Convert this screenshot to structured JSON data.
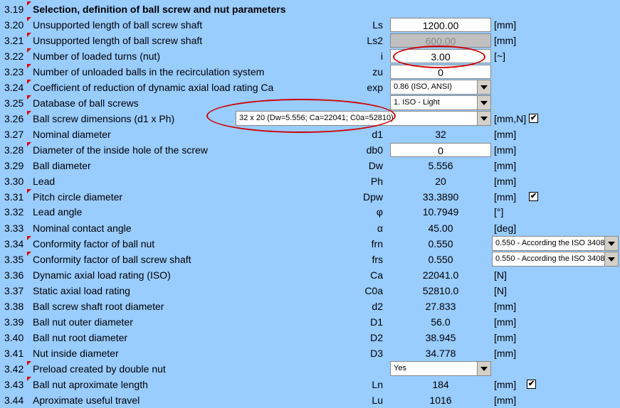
{
  "title_row": {
    "num": "3.19",
    "label": "Selection, definition of ball screw and nut parameters"
  },
  "rows": [
    {
      "num": "3.20",
      "label": "Unsupported length of ball screw shaft",
      "sym": "Ls",
      "value": "1200.00",
      "unit": "[mm]"
    },
    {
      "num": "3.21",
      "label": "Unsupported length of ball screw shaft",
      "sym": "Ls2",
      "value": "600.00",
      "unit": "[mm]"
    },
    {
      "num": "3.22",
      "label": "Number of loaded turns (nut)",
      "sym": "i",
      "value": "3.00",
      "unit": "[~]"
    },
    {
      "num": "3.23",
      "label": "Number of unloaded balls in the recirculation system",
      "sym": "zu",
      "value": "0",
      "unit": ""
    },
    {
      "num": "3.24",
      "label": "Coefficient of reduction of dynamic axial load rating Ca",
      "sym": "exp",
      "select": "0.86 (ISO, ANSI)",
      "unit": ""
    },
    {
      "num": "3.25",
      "label": "Database of ball screws",
      "sym": "",
      "select": "1. ISO - Light",
      "unit": ""
    },
    {
      "num": "3.26",
      "label": "Ball screw dimensions (d1 x Ph)",
      "sym": "",
      "select": "32 x 20  (Dw=5.556;  Ca=22041;  C0a=52810)",
      "unit": "[mm,N]"
    },
    {
      "num": "3.27",
      "label": "Nominal diameter",
      "sym": "d1",
      "value": "32",
      "unit": "[mm]"
    },
    {
      "num": "3.28",
      "label": "Diameter of the inside hole of the screw",
      "sym": "db0",
      "value": "0",
      "unit": "[mm]"
    },
    {
      "num": "3.29",
      "label": "Ball diameter",
      "sym": "Dw",
      "value": "5.556",
      "unit": "[mm]"
    },
    {
      "num": "3.30",
      "label": "Lead",
      "sym": "Ph",
      "value": "20",
      "unit": "[mm]"
    },
    {
      "num": "3.31",
      "label": "Pitch circle diameter",
      "sym": "Dpw",
      "value": "33.3890",
      "unit": "[mm]"
    },
    {
      "num": "3.32",
      "label": "Lead angle",
      "sym": "φ",
      "value": "10.7949",
      "unit": "[°]"
    },
    {
      "num": "3.33",
      "label": "Nominal contact angle",
      "sym": "α",
      "value": "45.00",
      "unit": "[deg]"
    },
    {
      "num": "3.34",
      "label": "Conformity factor of ball nut",
      "sym": "frn",
      "value": "0.550",
      "unit": "",
      "side_select": "0.550 - According the ISO 3408"
    },
    {
      "num": "3.35",
      "label": "Conformity factor of ball screw shaft",
      "sym": "frs",
      "value": "0.550",
      "unit": "",
      "side_select": "0.550 - According the ISO 3408"
    },
    {
      "num": "3.36",
      "label": "Dynamic axial load rating (ISO)",
      "sym": "Ca",
      "value": "22041.0",
      "unit": "[N]"
    },
    {
      "num": "3.37",
      "label": "Static axial load rating",
      "sym": "C0a",
      "value": "52810.0",
      "unit": "[N]"
    },
    {
      "num": "3.38",
      "label": "Ball screw shaft root diameter",
      "sym": "d2",
      "value": "27.833",
      "unit": "[mm]"
    },
    {
      "num": "3.39",
      "label": "Ball nut outer diameter",
      "sym": "D1",
      "value": "56.0",
      "unit": "[mm]"
    },
    {
      "num": "3.40",
      "label": "Ball nut root diameter",
      "sym": "D2",
      "value": "38.945",
      "unit": "[mm]"
    },
    {
      "num": "3.41",
      "label": "Nut inside diameter",
      "sym": "D3",
      "value": "34.778",
      "unit": "[mm]"
    },
    {
      "num": "3.42",
      "label": "Preload created by double nut",
      "sym": "",
      "select": "Yes",
      "unit": ""
    },
    {
      "num": "3.43",
      "label": "Ball nut aproximate length",
      "sym": "Ln",
      "value": "184",
      "unit": "[mm]"
    },
    {
      "num": "3.44",
      "label": "Aproximate useful travel",
      "sym": "Lu",
      "value": "1016",
      "unit": "[mm]"
    }
  ],
  "checkbox_mark": "✔"
}
